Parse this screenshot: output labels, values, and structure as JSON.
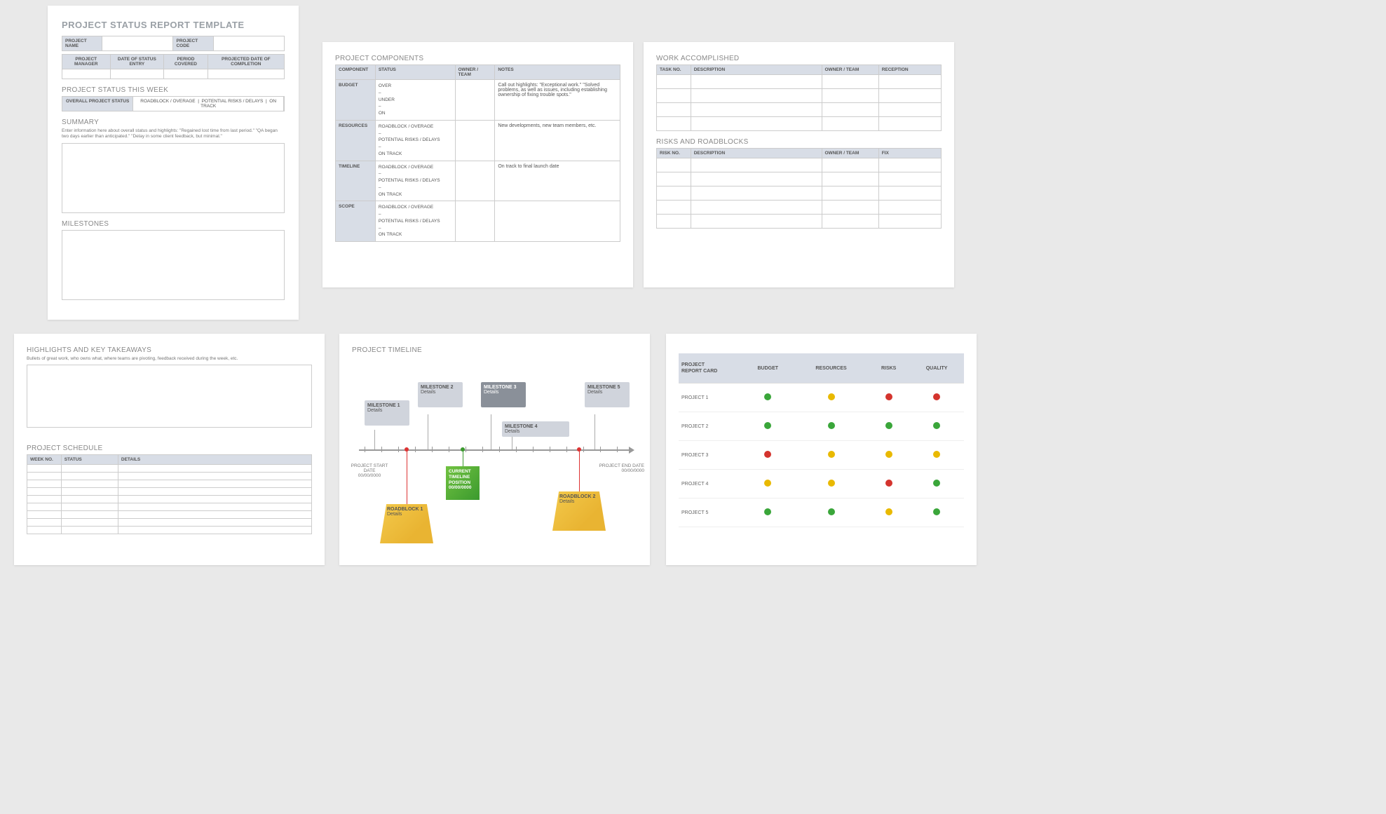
{
  "p1": {
    "title": "PROJECT STATUS REPORT TEMPLATE",
    "fields": {
      "name": "PROJECT NAME",
      "code": "PROJECT CODE",
      "mgr": "PROJECT MANAGER",
      "entry": "DATE OF STATUS ENTRY",
      "period": "PERIOD COVERED",
      "proj": "PROJECTED DATE OF COMPLETION"
    },
    "statusWeek": "PROJECT STATUS THIS WEEK",
    "overall": "OVERALL PROJECT STATUS",
    "opts": [
      "ROADBLOCK / OVERAGE",
      "POTENTIAL RISKS / DELAYS",
      "ON TRACK"
    ],
    "summary": "SUMMARY",
    "summaryDesc": "Enter information here about overall status and highlights: \"Regained lost time from last period.\" \"QA began two days earlier than anticipated.\" \"Delay in some client feedback, but minimal.\"",
    "milestones": "MILESTONES"
  },
  "p2": {
    "title": "PROJECT COMPONENTS",
    "headers": [
      "COMPONENT",
      "STATUS",
      "OWNER / TEAM",
      "NOTES"
    ],
    "rows": [
      {
        "c": "BUDGET",
        "s": "OVER\n–\nUNDER\n–\nON",
        "n": "Call out highlights: \"Exceptional work.\" \"Solved problems, as well as issues, including establishing ownership of fixing trouble spots.\""
      },
      {
        "c": "RESOURCES",
        "s": "ROADBLOCK / OVERAGE\n–\nPOTENTIAL RISKS / DELAYS\n–\nON TRACK",
        "n": "New developments, new team members, etc."
      },
      {
        "c": "TIMELINE",
        "s": "ROADBLOCK / OVERAGE\n–\nPOTENTIAL RISKS / DELAYS\n–\nON TRACK",
        "n": "On track to final launch date"
      },
      {
        "c": "SCOPE",
        "s": "ROADBLOCK / OVERAGE\n–\nPOTENTIAL RISKS / DELAYS\n–\nON TRACK",
        "n": ""
      }
    ]
  },
  "p3": {
    "wa": {
      "title": "WORK ACCOMPLISHED",
      "headers": [
        "TASK NO.",
        "DESCRIPTION",
        "OWNER / TEAM",
        "RECEPTION"
      ]
    },
    "rr": {
      "title": "RISKS AND ROADBLOCKS",
      "headers": [
        "RISK NO.",
        "DESCRIPTION",
        "OWNER / TEAM",
        "FIX"
      ]
    }
  },
  "p4": {
    "hl": {
      "title": "HIGHLIGHTS AND KEY TAKEAWAYS",
      "desc": "Bullets of great work, who owns what, where teams are pivoting, feedback received during the week, etc."
    },
    "sched": {
      "title": "PROJECT SCHEDULE",
      "headers": [
        "WEEK NO.",
        "STATUS",
        "DETAILS"
      ]
    }
  },
  "p5": {
    "title": "PROJECT TIMELINE",
    "start": {
      "l": "PROJECT START DATE",
      "d": "00/00/0000"
    },
    "end": {
      "l": "PROJECT END DATE",
      "d": "00/00/0000"
    },
    "milestones": [
      {
        "t": "MILESTONE 1",
        "d": "Details"
      },
      {
        "t": "MILESTONE 2",
        "d": "Details"
      },
      {
        "t": "MILESTONE 3",
        "d": "Details"
      },
      {
        "t": "MILESTONE 4",
        "d": "Details"
      },
      {
        "t": "MILESTONE 5",
        "d": "Details"
      }
    ],
    "roadblocks": [
      {
        "t": "ROADBLOCK 1",
        "d": "Details"
      },
      {
        "t": "ROADBLOCK 2",
        "d": "Details"
      }
    ],
    "current": {
      "l1": "CURRENT",
      "l2": "TIMELINE",
      "l3": "POSITION",
      "d": "00/00/0000"
    }
  },
  "p6": {
    "headers": [
      "PROJECT REPORT CARD",
      "BUDGET",
      "RESOURCES",
      "RISKS",
      "QUALITY"
    ],
    "rows": [
      {
        "p": "PROJECT 1",
        "c": [
          "g",
          "y",
          "r",
          "r"
        ]
      },
      {
        "p": "PROJECT 2",
        "c": [
          "g",
          "g",
          "g",
          "g"
        ]
      },
      {
        "p": "PROJECT 3",
        "c": [
          "r",
          "y",
          "y",
          "y"
        ]
      },
      {
        "p": "PROJECT 4",
        "c": [
          "y",
          "y",
          "r",
          "g"
        ]
      },
      {
        "p": "PROJECT 5",
        "c": [
          "g",
          "g",
          "y",
          "g"
        ]
      }
    ]
  }
}
